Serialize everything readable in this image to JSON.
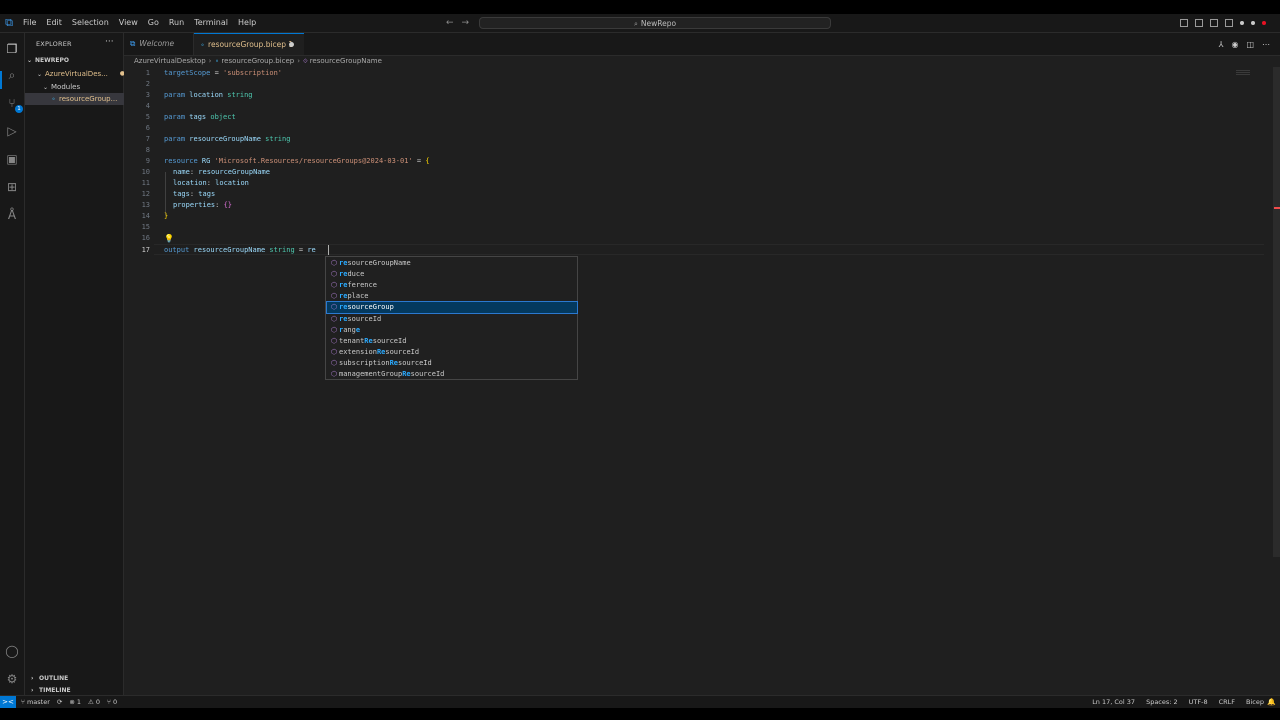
{
  "titlebar": {
    "menu": [
      "File",
      "Edit",
      "Selection",
      "View",
      "Go",
      "Run",
      "Terminal",
      "Help"
    ],
    "search_text": "NewRepo",
    "back_arrow": "←",
    "forward_arrow": "→"
  },
  "activitybar": {
    "items": [
      "explorer-icon",
      "search-icon",
      "source-control-icon",
      "run-debug-icon",
      "remote-explorer-icon",
      "extensions-icon",
      "azure-icon"
    ],
    "source_control_badge": "1",
    "bottom": [
      "account-icon",
      "settings-gear-icon"
    ]
  },
  "sidebar": {
    "header": "EXPLORER",
    "more": "···",
    "root": "NEWREPO",
    "folder": "AzureVirtualDes...",
    "folder_status": "●",
    "subfolder": "Modules",
    "file": "resourceGroup...",
    "file_count": "1",
    "outline": "OUTLINE",
    "timeline": "TIMELINE"
  },
  "tabs": {
    "welcome": "Welcome",
    "active": "resourceGroup.bicep 1"
  },
  "breadcrumb": {
    "folder": "AzureVirtualDesktop",
    "file": "resourceGroup.bicep",
    "symbol": "resourceGroupName"
  },
  "editor": {
    "line_numbers": [
      "1",
      "2",
      "3",
      "4",
      "5",
      "6",
      "7",
      "8",
      "9",
      "10",
      "11",
      "12",
      "13",
      "14",
      "15",
      "16",
      "17"
    ],
    "lines": {
      "l1": [
        "targetScope",
        " = ",
        "'subscription'"
      ],
      "l3": [
        "param",
        " location ",
        "string"
      ],
      "l5": [
        "param",
        " tags ",
        "object"
      ],
      "l7": [
        "param",
        " resourceGroupName ",
        "string"
      ],
      "l9": [
        "resource",
        " RG ",
        "'Microsoft.Resources/resourceGroups@2024-03-01'",
        " = ",
        "{"
      ],
      "l10": [
        "name",
        ": ",
        "resourceGroupName"
      ],
      "l11": [
        "location",
        ": ",
        "location"
      ],
      "l12": [
        "tags",
        ": ",
        "tags"
      ],
      "l13": [
        "properties",
        ": ",
        "{}"
      ],
      "l14": [
        "}"
      ],
      "l17": [
        "output",
        " resourceGroupName ",
        "string",
        " = ",
        "re"
      ]
    },
    "bulb": "💡"
  },
  "suggestions": [
    {
      "match": "re",
      "rest": "sourceGroupName"
    },
    {
      "match": "re",
      "rest": "duce"
    },
    {
      "match": "re",
      "rest": "ference"
    },
    {
      "match": "re",
      "rest": "place"
    },
    {
      "match": "re",
      "rest": "sourceGroup"
    },
    {
      "match": "re",
      "rest": "sourceId"
    },
    {
      "pre": "",
      "match": "r",
      "mid": "ang",
      "match2": "e",
      "rest": ""
    },
    {
      "pre": "tenant",
      "match": "Re",
      "rest": "sourceId"
    },
    {
      "pre": "extension",
      "match": "Re",
      "rest": "sourceId"
    },
    {
      "pre": "subscription",
      "match": "Re",
      "rest": "sourceId"
    },
    {
      "pre": "managementGroup",
      "match": "Re",
      "rest": "sourceId"
    }
  ],
  "selected_suggestion": 4,
  "statusbar": {
    "remote": "><",
    "branch": "master",
    "errors": "⊗ 1",
    "warnings": "⚠ 0",
    "ports": "⑂ 0",
    "position": "Ln 17, Col 37",
    "spaces": "Spaces: 2",
    "encoding": "UTF-8",
    "eol": "CRLF",
    "language": "Bicep",
    "bell": "🔔"
  },
  "colors": {
    "accent": "#0078d4",
    "keyword": "#569cd6",
    "string": "#ce9178",
    "type": "#4ec9b0",
    "highlight": "#2aaaff",
    "modified": "#e2c08d"
  }
}
